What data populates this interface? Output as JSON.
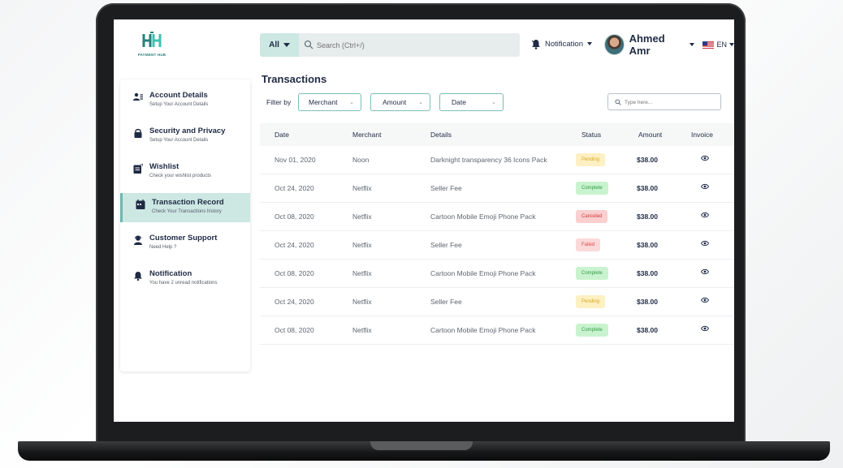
{
  "app": {
    "logo_text": "PAYMENT HUB",
    "search": {
      "scope": "All",
      "placeholder": "Search (Ctrl+/)"
    },
    "notification_label": "Notification",
    "user_name": "Ahmed Amr",
    "language": "EN"
  },
  "sidebar": {
    "items": [
      {
        "title": "Account Details",
        "subtitle": "Setup Your Account Details",
        "icon": "user-list-icon",
        "active": false
      },
      {
        "title": "Security and Privacy",
        "subtitle": "Setup Your Account Details",
        "icon": "lock-icon",
        "active": false
      },
      {
        "title": "Wishlist",
        "subtitle": "Check your wishlist products",
        "icon": "wishlist-icon",
        "active": false
      },
      {
        "title": "Transaction Record",
        "subtitle": "Check Your Transactions history",
        "icon": "calendar-icon",
        "active": true
      },
      {
        "title": "Customer Support",
        "subtitle": "Need Help ?",
        "icon": "support-agent-icon",
        "active": false
      },
      {
        "title": "Notification",
        "subtitle": "You have 2 unread notifications",
        "icon": "bell-icon",
        "active": false
      }
    ]
  },
  "main": {
    "title": "Transactions",
    "filter_label": "Filter by",
    "filters": [
      "Merchant",
      "Amount",
      "Date"
    ],
    "table_search_placeholder": "Type here...",
    "columns": [
      "Date",
      "Merchant",
      "Details",
      "Status",
      "Amount",
      "Invoice"
    ],
    "rows": [
      {
        "date": "Nov 01, 2020",
        "merchant": "Noon",
        "details": "Darknight transparency  36 Icons Pack",
        "status": "Pending",
        "amount": "$38.00"
      },
      {
        "date": "Oct 24, 2020",
        "merchant": "Netflix",
        "details": "Seller Fee",
        "status": "Complete",
        "amount": "$38.00"
      },
      {
        "date": "Oct 08, 2020",
        "merchant": "Netflix",
        "details": "Cartoon Mobile Emoji Phone Pack",
        "status": "Canceled",
        "amount": "$38.00"
      },
      {
        "date": "Oct 24, 2020",
        "merchant": "Netflix",
        "details": "Seller Fee",
        "status": "Failed",
        "amount": "$38.00"
      },
      {
        "date": "Oct 08, 2020",
        "merchant": "Netflix",
        "details": "Cartoon Mobile Emoji Phone Pack",
        "status": "Complete",
        "amount": "$38.00"
      },
      {
        "date": "Oct 24, 2020",
        "merchant": "Netflix",
        "details": "Seller Fee",
        "status": "Pending",
        "amount": "$38.00"
      },
      {
        "date": "Oct 08, 2020",
        "merchant": "Netflix",
        "details": "Cartoon Mobile Emoji Phone Pack",
        "status": "Complete",
        "amount": "$38.00"
      }
    ]
  },
  "colors": {
    "accent": "#cde7e3",
    "accent_border": "#7bbeb5",
    "text_dark": "#1f2a44",
    "status": {
      "Pending": {
        "bg": "#fdf0c2",
        "fg": "#d9a627"
      },
      "Complete": {
        "bg": "#c9f3cf",
        "fg": "#2f9b44"
      },
      "Canceled": {
        "bg": "#f9cfcf",
        "fg": "#d23b3b"
      },
      "Failed": {
        "bg": "#fbd9d9",
        "fg": "#e04848"
      }
    }
  }
}
